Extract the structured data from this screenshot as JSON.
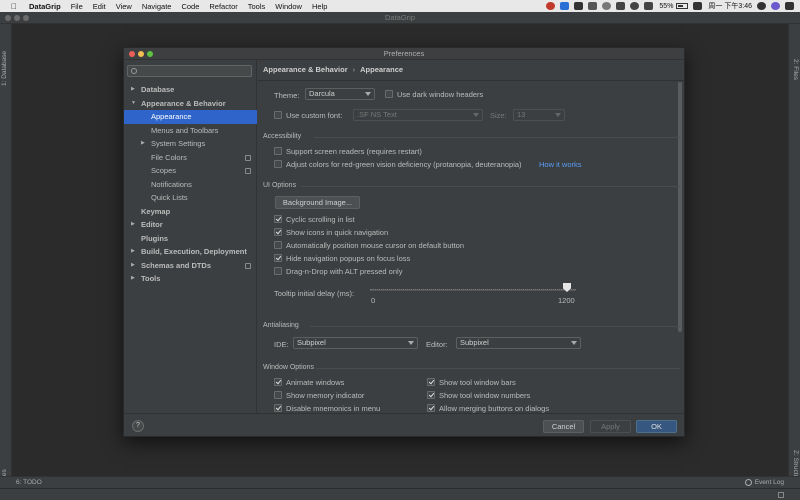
{
  "menubar": {
    "app": "DataGrip",
    "items": [
      "File",
      "Edit",
      "View",
      "Navigate",
      "Code",
      "Refactor",
      "Tools",
      "Window",
      "Help"
    ],
    "battery": "55%",
    "clock": "周一 下午3:46"
  },
  "ide_title": "DataGrip",
  "left_stripe": {
    "database": "1: Database",
    "favorites": "Favorites"
  },
  "right_stripe": {
    "files": "2: Files",
    "structure": "Z: Structure"
  },
  "bottom": {
    "todo": "6: TODO",
    "event_log": "Event Log"
  },
  "dialog": {
    "title": "Preferences",
    "breadcrumb": [
      "Appearance & Behavior",
      "Appearance"
    ],
    "tree": [
      {
        "label": "Database",
        "bold": true,
        "arrow": true
      },
      {
        "label": "Appearance & Behavior",
        "bold": true,
        "arrow": true,
        "expanded": true
      },
      {
        "label": "Appearance",
        "selected": true
      },
      {
        "label": "Menus and Toolbars"
      },
      {
        "label": "System Settings",
        "arrow": true
      },
      {
        "label": "File Colors",
        "copy": true
      },
      {
        "label": "Scopes",
        "copy": true
      },
      {
        "label": "Notifications"
      },
      {
        "label": "Quick Lists"
      },
      {
        "label": "Keymap",
        "bold": true
      },
      {
        "label": "Editor",
        "bold": true,
        "arrow": true
      },
      {
        "label": "Plugins",
        "bold": true
      },
      {
        "label": "Build, Execution, Deployment",
        "bold": true,
        "arrow": true
      },
      {
        "label": "Schemas and DTDs",
        "bold": true,
        "arrow": true,
        "copy": true
      },
      {
        "label": "Tools",
        "bold": true,
        "arrow": true
      }
    ],
    "theme": {
      "label": "Theme:",
      "value": "Darcula",
      "dark_headers": "Use dark window headers"
    },
    "font": {
      "label": "Use custom font:",
      "value": ".SF NS Text",
      "size_label": "Size:",
      "size": "13"
    },
    "accessibility": {
      "title": "Accessibility",
      "screen_readers": "Support screen readers (requires restart)",
      "adjust_colors": "Adjust colors for red-green vision deficiency (protanopia, deuteranopia)",
      "how_it_works": "How it works"
    },
    "ui_options": {
      "title": "UI Options",
      "background_image": "Background Image...",
      "cyclic": "Cyclic scrolling in list",
      "icons": "Show icons in quick navigation",
      "mouse": "Automatically position mouse cursor on default button",
      "hide_popups": "Hide navigation popups on focus loss",
      "dnd": "Drag-n-Drop with ALT pressed only",
      "tooltip_label": "Tooltip initial delay (ms):",
      "tooltip_min": "0",
      "tooltip_max": "1200",
      "tooltip_value": 1200
    },
    "antialiasing": {
      "title": "Antialiasing",
      "ide_label": "IDE:",
      "ide_value": "Subpixel",
      "editor_label": "Editor:",
      "editor_value": "Subpixel"
    },
    "window_options": {
      "title": "Window Options",
      "animate": "Animate windows",
      "memory": "Show memory indicator",
      "mnemonics": "Disable mnemonics in menu",
      "tool_bars": "Show tool window bars",
      "tool_numbers": "Show tool window numbers",
      "merging": "Allow merging buttons on dialogs"
    },
    "footer": {
      "help": "?",
      "cancel": "Cancel",
      "apply": "Apply",
      "ok": "OK"
    }
  }
}
